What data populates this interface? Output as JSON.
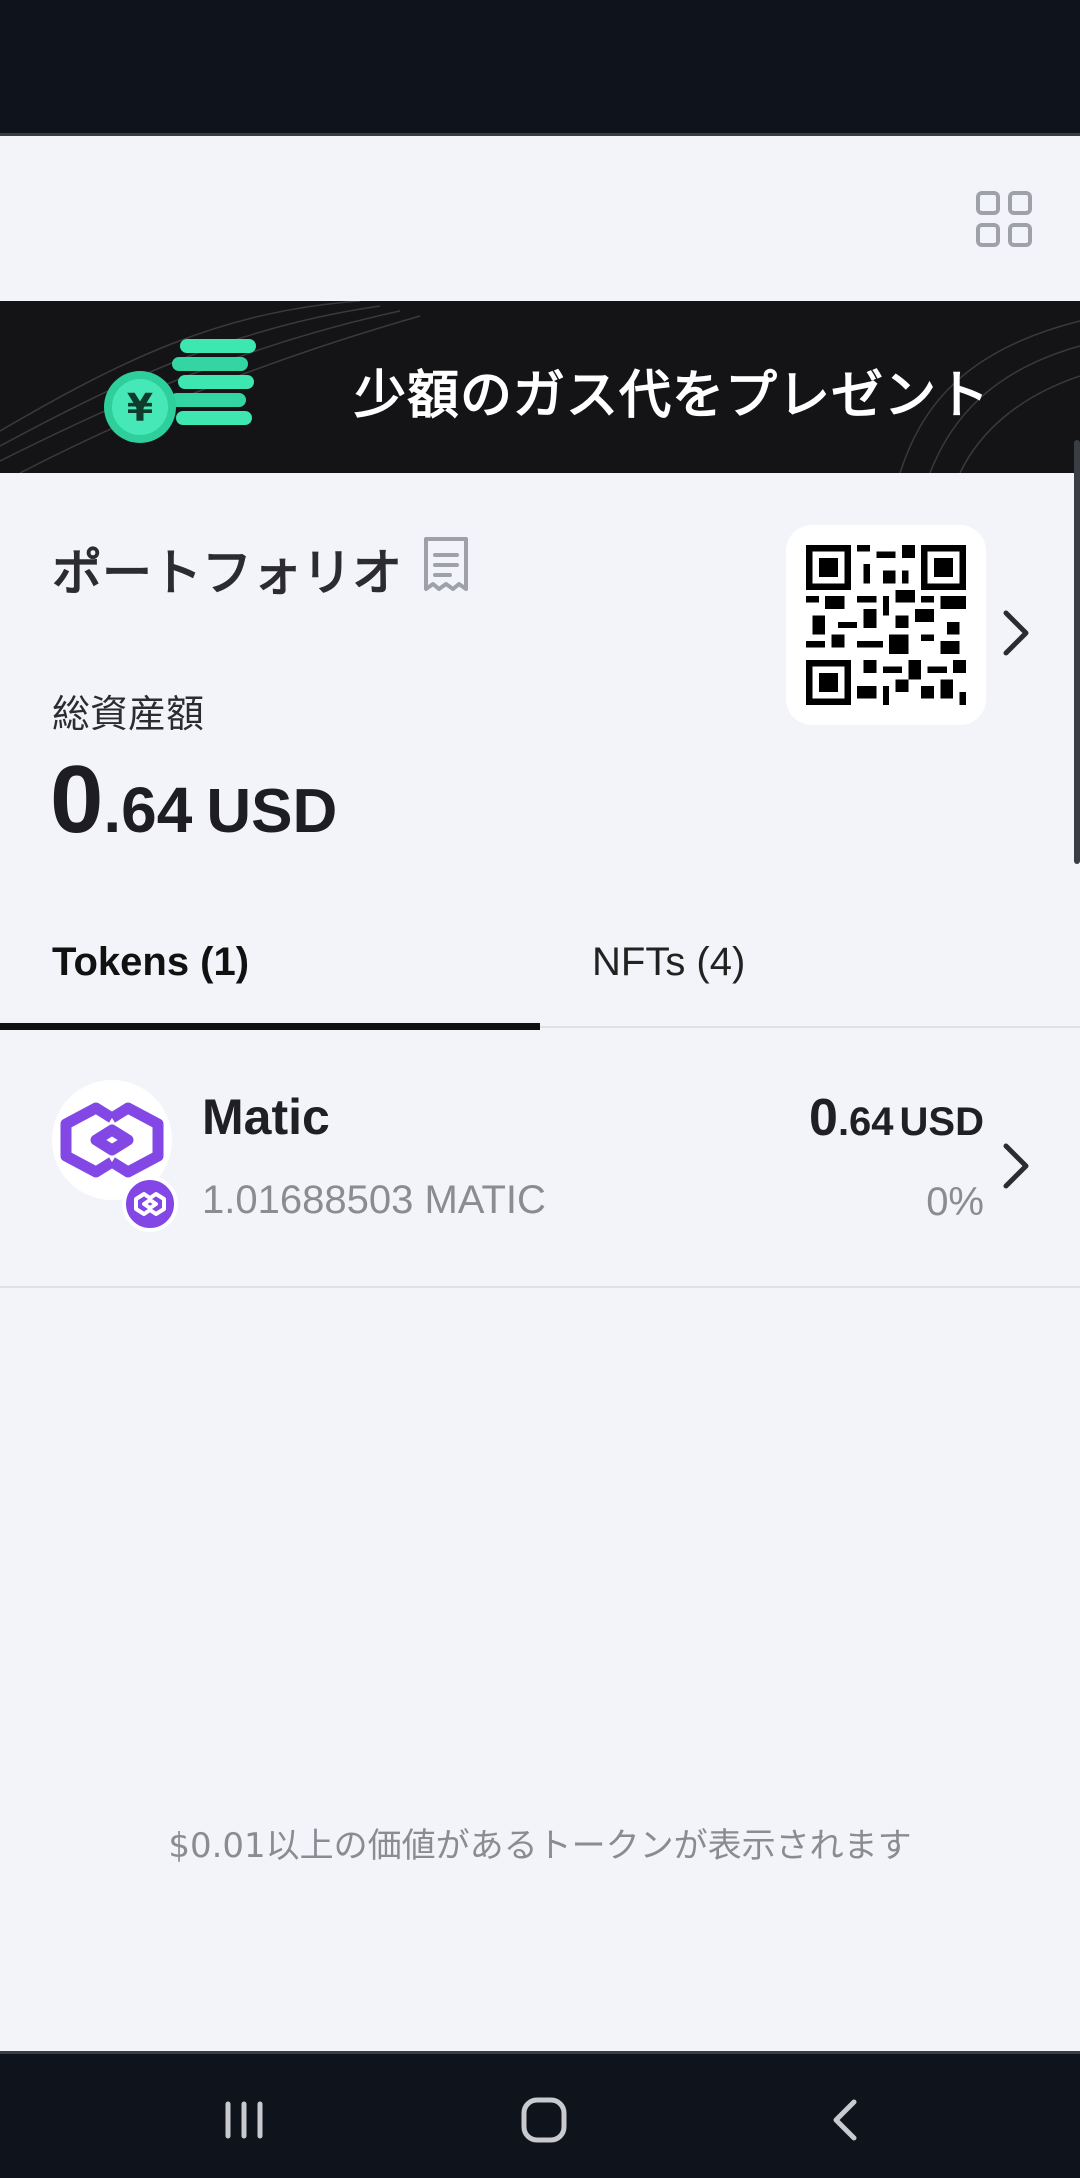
{
  "banner": {
    "title": "少額のガス代をプレゼント",
    "accent": "#3ee6b0"
  },
  "portfolio": {
    "title": "ポートフォリオ",
    "total_label": "総資産額",
    "total_int": "0",
    "total_dec": ".64",
    "total_currency": "USD"
  },
  "tabs": [
    {
      "label": "Tokens (1)",
      "selected": true
    },
    {
      "label": "NFTs (4)",
      "selected": false
    }
  ],
  "tokens": [
    {
      "name": "Matic",
      "amount": "1.01688503 MATIC",
      "value_int": "0",
      "value_dec": ".64",
      "value_currency": "USD",
      "change": "0%",
      "icon": "polygon-icon",
      "brand_color": "#8247e5"
    }
  ],
  "footer_note": "$0.01以上の価値があるトークンが表示されます",
  "icons": {
    "header": "grid-icon",
    "portfolio": "receipt-icon",
    "qr": "qr-code-icon",
    "nav": [
      "recents-icon",
      "home-icon",
      "back-icon"
    ]
  }
}
